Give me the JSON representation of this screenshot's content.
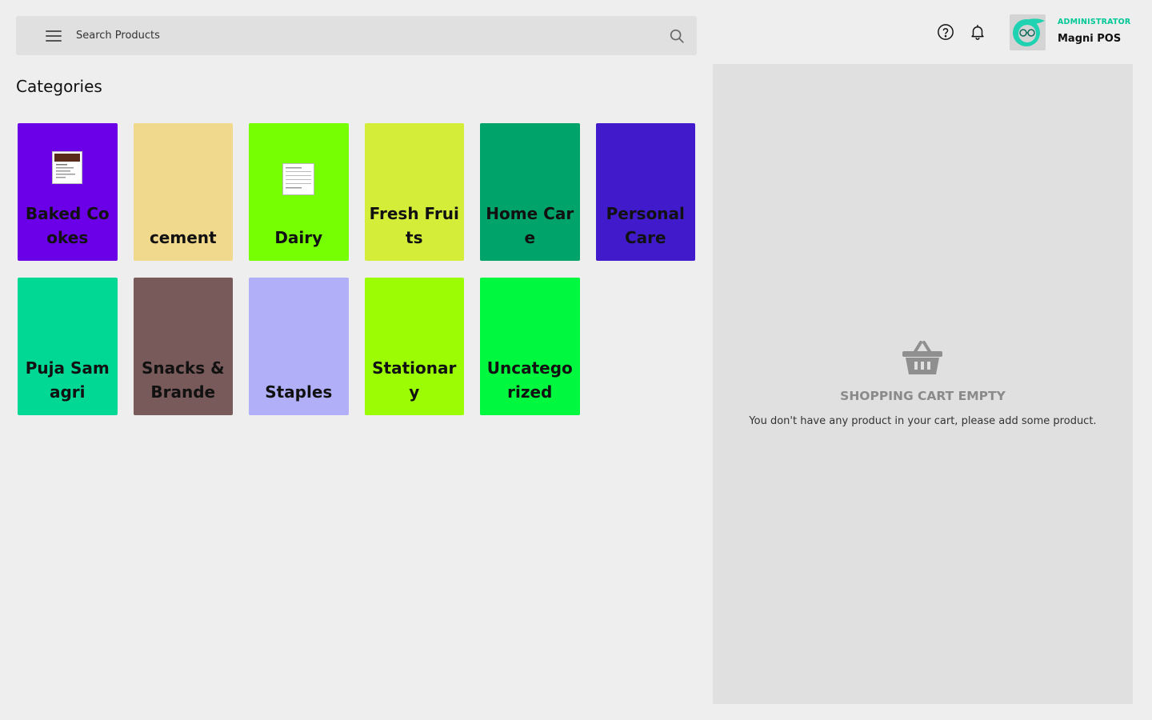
{
  "search": {
    "placeholder": "Search Products"
  },
  "header": {
    "role": "ADMINISTRATOR",
    "user_name": "Magni POS",
    "accent_color": "#00c896"
  },
  "categories": {
    "title": "Categories",
    "items": [
      {
        "label": "Baked Cookes",
        "color": "#6b00e8",
        "thumbnail": true
      },
      {
        "label": "cement",
        "color": "#f0d88c",
        "thumbnail": false
      },
      {
        "label": "Dairy",
        "color": "#76ff03",
        "thumbnail": true
      },
      {
        "label": "Fresh Fruits",
        "color": "#d4ed39",
        "thumbnail": false
      },
      {
        "label": "Home Care",
        "color": "#00a46b",
        "thumbnail": false
      },
      {
        "label": "Personal Care",
        "color": "#411bcb",
        "thumbnail": false
      },
      {
        "label": "Puja Samagri",
        "color": "#00d894",
        "thumbnail": false
      },
      {
        "label": "Snacks & Branded…",
        "color": "#795a5a",
        "thumbnail": false
      },
      {
        "label": "Staples",
        "color": "#b0aff8",
        "thumbnail": false
      },
      {
        "label": "Stationary",
        "color": "#9cfc03",
        "thumbnail": false
      },
      {
        "label": "Uncategorized",
        "color": "#00f93f",
        "thumbnail": false
      }
    ]
  },
  "cart": {
    "empty_title": "SHOPPING CART EMPTY",
    "empty_text": "You don't have any product in your cart, please add some product."
  }
}
